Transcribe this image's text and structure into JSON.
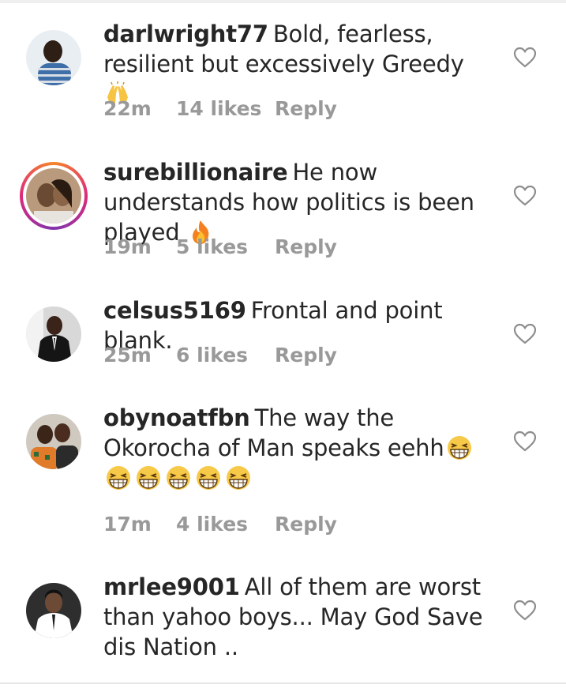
{
  "comments": [
    {
      "username": "darlwright77",
      "text": "Bold, fearless, resilient but excessively Greedy",
      "emoji": "raising-hands",
      "time": "22m",
      "likes": "14 likes",
      "reply": "Reply",
      "has_story_ring": false
    },
    {
      "username": "surebillionaire",
      "text": "He now understands how politics is been played",
      "emoji": "fire",
      "time": "19m",
      "likes": "5 likes",
      "reply": "Reply",
      "has_story_ring": true
    },
    {
      "username": "celsus5169",
      "text": "Frontal and point blank.",
      "time": "25m",
      "likes": "6 likes",
      "reply": "Reply",
      "has_story_ring": false
    },
    {
      "username": "obynoatfbn",
      "text": "The way the Okorocha of Man speaks eehh",
      "emoji": "grinning-squinting-face",
      "emoji_count": 6,
      "time": "17m",
      "likes": "4 likes",
      "reply": "Reply",
      "has_story_ring": false
    },
    {
      "username": "mrlee9001",
      "text": "All of them are worst than yahoo boys... May God Save dis Nation ..",
      "has_story_ring": false
    }
  ],
  "colors": {
    "text": "#262626",
    "meta": "#999999",
    "story_ring": [
      "#f58529",
      "#dd2a7b",
      "#8134af"
    ]
  },
  "icons": {
    "like": "heart-outline-icon"
  }
}
